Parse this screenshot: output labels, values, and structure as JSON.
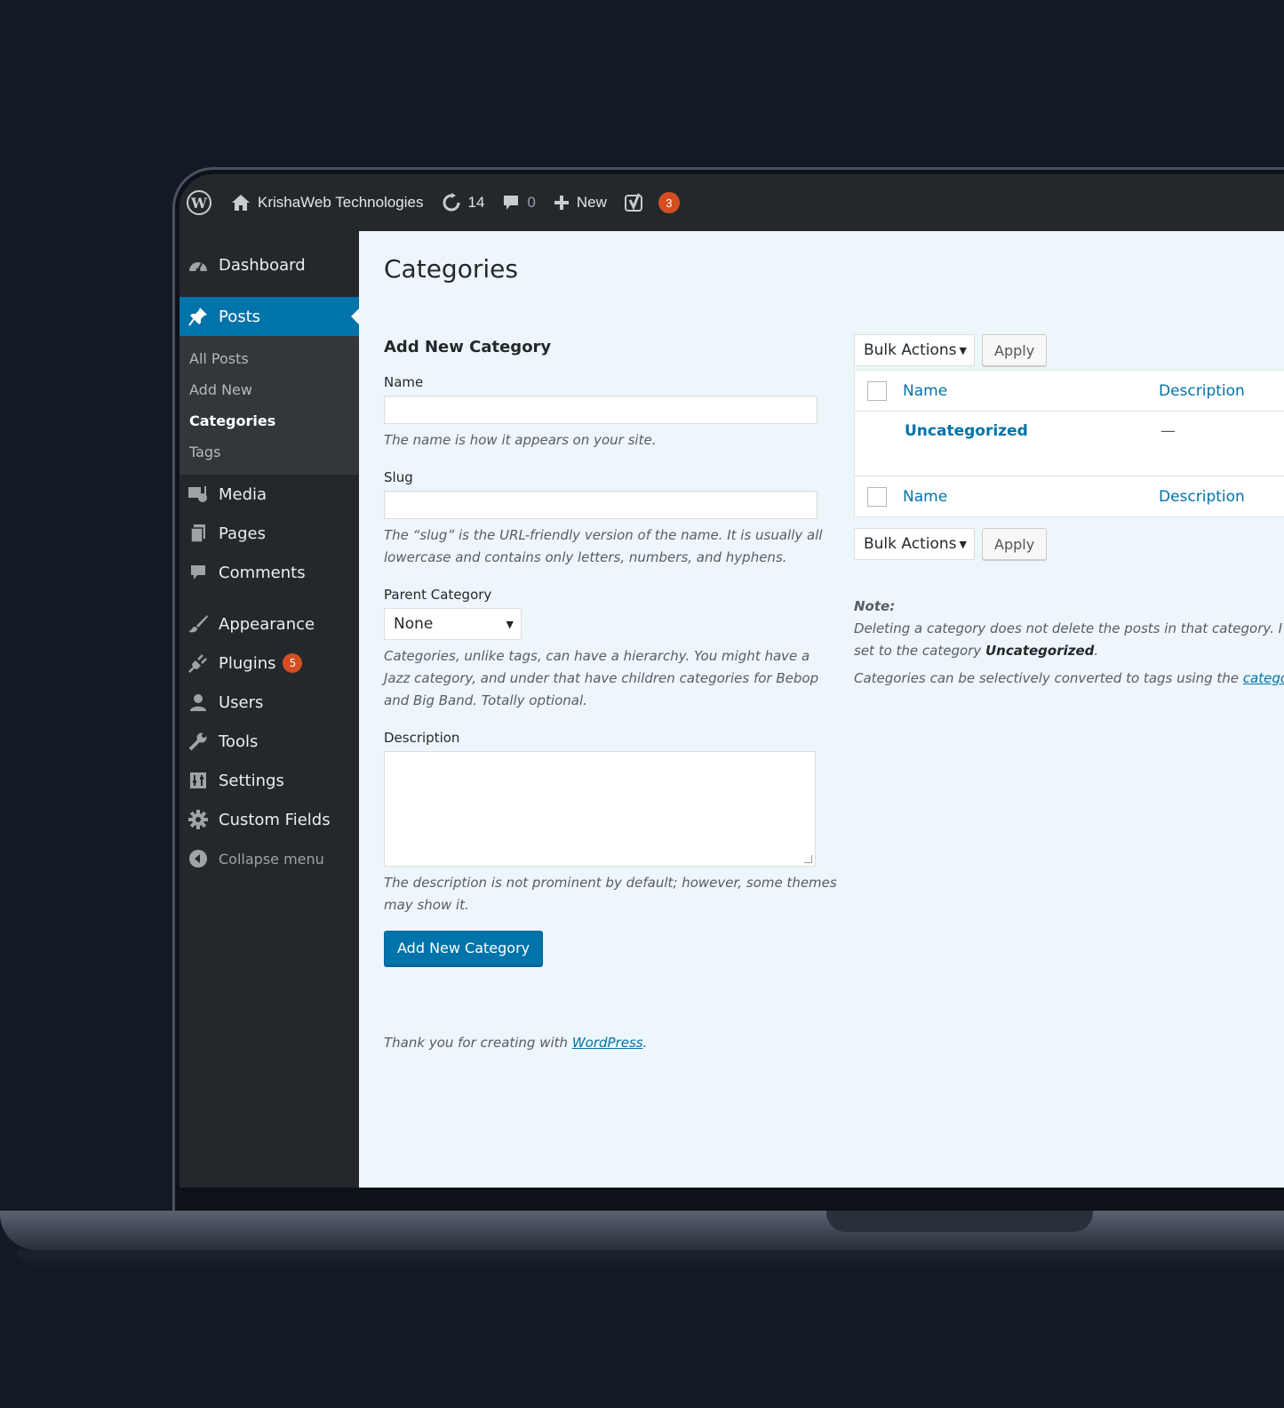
{
  "adminbar": {
    "site_name": "KrishaWeb Technologies",
    "updates_count": "14",
    "comments_count": "0",
    "new_label": "New",
    "yoast_badge": "3"
  },
  "sidebar": {
    "dashboard": "Dashboard",
    "posts": "Posts",
    "posts_sub": [
      "All Posts",
      "Add New",
      "Categories",
      "Tags"
    ],
    "media": "Media",
    "pages": "Pages",
    "comments": "Comments",
    "appearance": "Appearance",
    "plugins": "Plugins",
    "plugins_badge": "5",
    "users": "Users",
    "tools": "Tools",
    "settings": "Settings",
    "custom_fields": "Custom Fields",
    "collapse": "Collapse menu"
  },
  "page": {
    "title": "Categories"
  },
  "form": {
    "heading": "Add New Category",
    "name_label": "Name",
    "name_help": "The name is how it appears on your site.",
    "slug_label": "Slug",
    "slug_help": "The “slug” is the URL-friendly version of the name. It is usually all lowercase and contains only letters, numbers, and hyphens.",
    "parent_label": "Parent Category",
    "parent_value": "None",
    "parent_help": "Categories, unlike tags, can have a hierarchy. You might have a Jazz category, and under that have children categories for Bebop and Big Band. Totally optional.",
    "description_label": "Description",
    "description_help": "The description is not prominent by default; however, some themes may show it.",
    "submit_label": "Add New Category"
  },
  "table": {
    "bulk_actions": "Bulk Actions",
    "apply": "Apply",
    "col_name": "Name",
    "col_description": "Description",
    "rows": [
      {
        "name": "Uncategorized",
        "description": "—"
      }
    ]
  },
  "note": {
    "label": "Note:",
    "line1": "Deleting a category does not delete the posts in that category. I",
    "line2_prefix": "set to the category ",
    "line2_bold": "Uncategorized",
    "line2_suffix": ".",
    "line3_prefix": "Categories can be selectively converted to tags using the ",
    "line3_link": "catego"
  },
  "footer": {
    "text": "Thank you for creating with ",
    "link": "WordPress",
    "suffix": "."
  },
  "colors": {
    "accent": "#0073aa",
    "sidebar_bg": "#23282d",
    "content_bg": "#edf6fa",
    "badge": "#d54e21"
  }
}
